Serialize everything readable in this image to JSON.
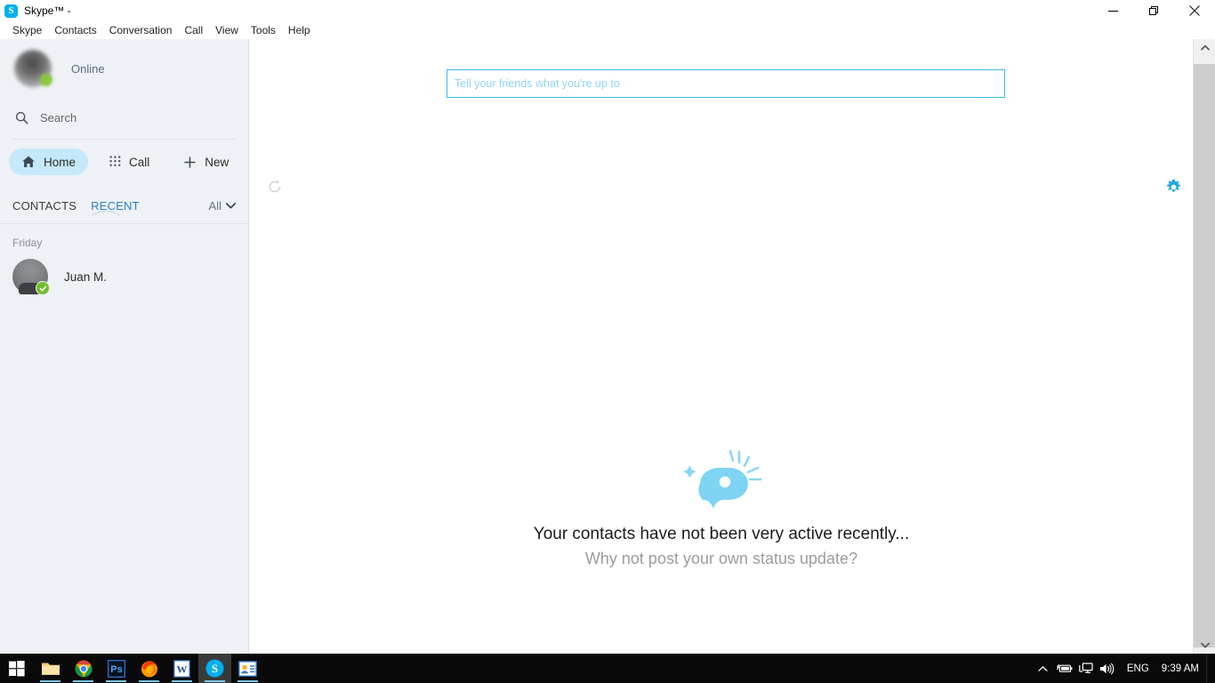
{
  "window": {
    "title": "Skype™ -",
    "logo_letter": "S",
    "controls": {
      "minimize": "minimize-icon",
      "maximize": "maximize-icon",
      "close": "close-icon"
    }
  },
  "menubar": {
    "items": [
      {
        "label": "Skype"
      },
      {
        "label": "Contacts"
      },
      {
        "label": "Conversation"
      },
      {
        "label": "Call"
      },
      {
        "label": "View"
      },
      {
        "label": "Tools"
      },
      {
        "label": "Help"
      }
    ]
  },
  "sidebar": {
    "profile": {
      "status": "Online",
      "status_color": "#8cc63e"
    },
    "search": {
      "placeholder": "Search",
      "icon": "search-icon"
    },
    "nav": [
      {
        "label": "Home",
        "icon": "home-icon",
        "active": true
      },
      {
        "label": "Call",
        "icon": "dialpad-icon",
        "active": false
      },
      {
        "label": "New",
        "icon": "plus-icon",
        "active": false
      }
    ],
    "tabs": [
      {
        "label": "CONTACTS",
        "active": false
      },
      {
        "label": "RECENT",
        "active": true
      }
    ],
    "filter": {
      "label": "All",
      "icon": "chevron-down-icon"
    },
    "groups": [
      {
        "date": "Friday",
        "contacts": [
          {
            "name": "Juan M.",
            "badge": "check-badge"
          }
        ]
      }
    ]
  },
  "main": {
    "status_input": {
      "placeholder": "Tell your friends what you're up to",
      "value": ""
    },
    "refresh": {
      "icon": "refresh-icon"
    },
    "settings": {
      "icon": "gear-icon"
    },
    "empty_state": {
      "icon": "speech-bubble-icon",
      "title": "Your contacts have not been very active recently...",
      "subtitle": "Why not post your own status update?"
    }
  },
  "scrollbar": {
    "up": "chevron-up-icon",
    "down": "chevron-down-icon"
  },
  "taskbar": {
    "items": [
      {
        "name": "start",
        "label": "Windows Start"
      },
      {
        "name": "file-explorer",
        "label": "File Explorer"
      },
      {
        "name": "chrome",
        "label": "Google Chrome"
      },
      {
        "name": "photoshop",
        "label": "Ps"
      },
      {
        "name": "firefox",
        "label": "Firefox"
      },
      {
        "name": "word",
        "label": "W"
      },
      {
        "name": "skype",
        "label": "S"
      },
      {
        "name": "contacts-app",
        "label": "Contacts"
      }
    ],
    "tray": {
      "icons": [
        "chevron-up-icon",
        "battery-icon",
        "network-icon",
        "volume-icon"
      ],
      "language": "ENG",
      "clock": "9:39 AM"
    }
  },
  "colors": {
    "accent": "#00aff0",
    "sidebar_bg": "#eef1f5",
    "active_pill": "#c5e9fb",
    "online_green": "#8cc63e",
    "empty_icon": "#7ed4f2"
  }
}
